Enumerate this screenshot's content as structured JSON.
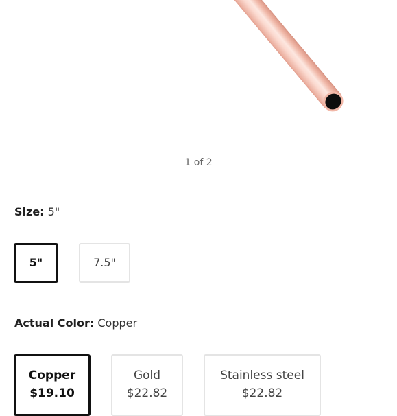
{
  "gallery": {
    "pager_text": "1 of 2"
  },
  "size_option": {
    "label": "Size:",
    "selected_value": "5\"",
    "choices": [
      {
        "label": "5\"",
        "selected": true
      },
      {
        "label": "7.5\"",
        "selected": false
      }
    ]
  },
  "color_option": {
    "label": "Actual Color:",
    "selected_value": "Copper",
    "choices": [
      {
        "name": "Copper",
        "price": "$19.10",
        "selected": true
      },
      {
        "name": "Gold",
        "price": "$22.82",
        "selected": false
      },
      {
        "name": "Stainless steel",
        "price": "$22.82",
        "selected": false
      }
    ]
  },
  "colors": {
    "straw_copper": "#f7c9bd",
    "selected_border": "#111111",
    "unselected_border": "#e4e4e4"
  }
}
